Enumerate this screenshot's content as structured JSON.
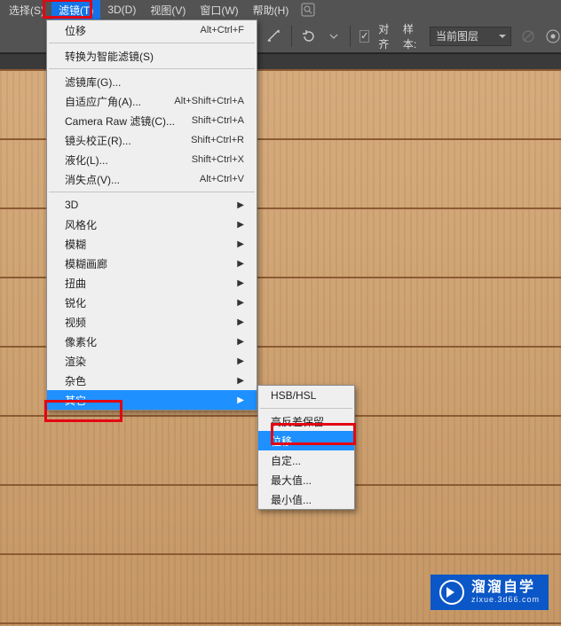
{
  "menubar": {
    "items": [
      {
        "label": "选择(S)"
      },
      {
        "label": "滤镜(T)"
      },
      {
        "label": "3D(D)"
      },
      {
        "label": "视图(V)"
      },
      {
        "label": "窗口(W)"
      },
      {
        "label": "帮助(H)"
      }
    ]
  },
  "toolbar": {
    "align_label": "对齐",
    "sample_label": "样本:",
    "sample_value": "当前图层"
  },
  "dropdown": {
    "section1": [
      {
        "label": "位移",
        "shortcut": "Alt+Ctrl+F"
      }
    ],
    "section2": [
      {
        "label": "转换为智能滤镜(S)",
        "shortcut": ""
      }
    ],
    "section3": [
      {
        "label": "滤镜库(G)...",
        "shortcut": ""
      },
      {
        "label": "自适应广角(A)...",
        "shortcut": "Alt+Shift+Ctrl+A"
      },
      {
        "label": "Camera Raw 滤镜(C)...",
        "shortcut": "Shift+Ctrl+A"
      },
      {
        "label": "镜头校正(R)...",
        "shortcut": "Shift+Ctrl+R"
      },
      {
        "label": "液化(L)...",
        "shortcut": "Shift+Ctrl+X"
      },
      {
        "label": "消失点(V)...",
        "shortcut": "Alt+Ctrl+V"
      }
    ],
    "section4": [
      {
        "label": "3D"
      },
      {
        "label": "风格化"
      },
      {
        "label": "模糊"
      },
      {
        "label": "模糊画廊"
      },
      {
        "label": "扭曲"
      },
      {
        "label": "锐化"
      },
      {
        "label": "视频"
      },
      {
        "label": "像素化"
      },
      {
        "label": "渲染"
      },
      {
        "label": "杂色"
      },
      {
        "label": "其它"
      }
    ]
  },
  "submenu": {
    "section1": [
      {
        "label": "HSB/HSL"
      }
    ],
    "section2": [
      {
        "label": "高反差保留..."
      },
      {
        "label": "位移..."
      },
      {
        "label": "自定..."
      },
      {
        "label": "最大值..."
      },
      {
        "label": "最小值..."
      }
    ]
  },
  "watermark": {
    "brand": "溜溜自学",
    "url": "zixue.3d66.com"
  }
}
